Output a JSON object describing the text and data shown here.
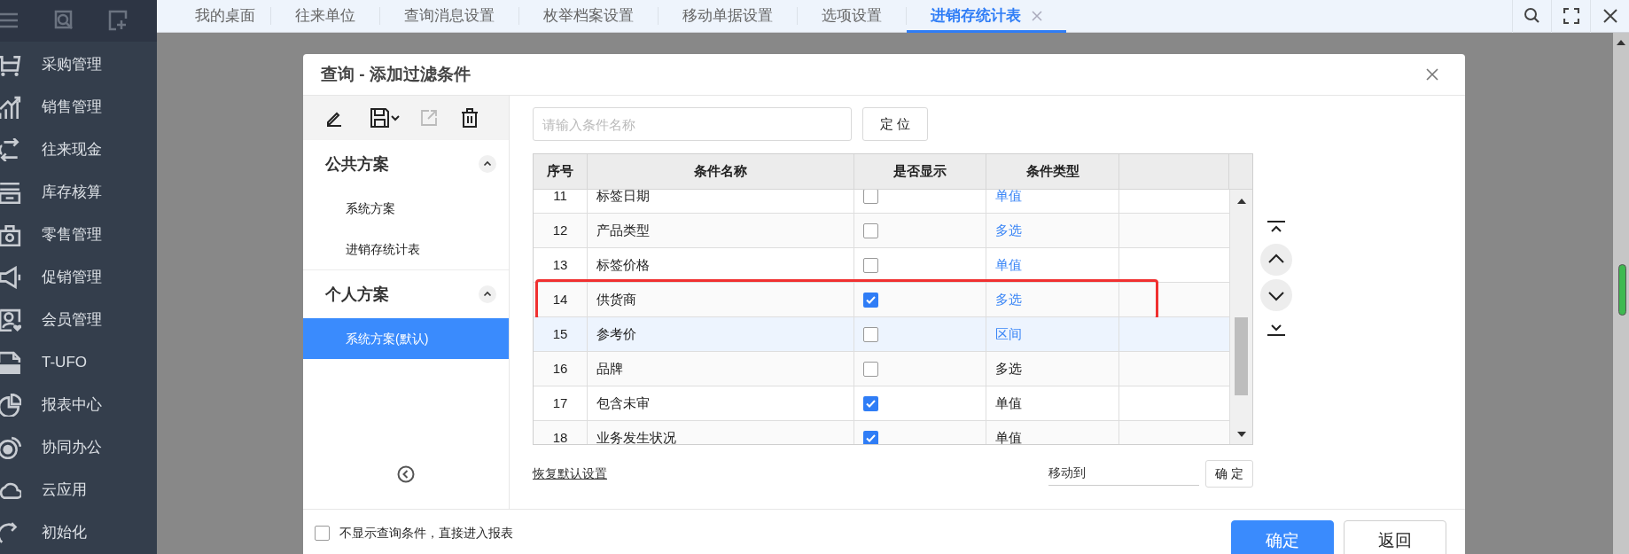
{
  "sidebar": {
    "items": [
      {
        "label": "采购管理",
        "kind": "cart"
      },
      {
        "label": "销售管理",
        "kind": "chart"
      },
      {
        "label": "往来现金",
        "kind": "swap"
      },
      {
        "label": "库存核算",
        "kind": "stock"
      },
      {
        "label": "零售管理",
        "kind": "bag"
      },
      {
        "label": "促销管理",
        "kind": "horn"
      },
      {
        "label": "会员管理",
        "kind": "member"
      },
      {
        "label": "T-UFO",
        "kind": "file"
      },
      {
        "label": "报表中心",
        "kind": "pie"
      },
      {
        "label": "协同办公",
        "kind": "signal"
      },
      {
        "label": "云应用",
        "kind": "cloud"
      },
      {
        "label": "初始化",
        "kind": "refresh"
      }
    ]
  },
  "tabs": [
    {
      "label": "我的桌面",
      "selected": false
    },
    {
      "label": "往来单位",
      "selected": false
    },
    {
      "label": "查询消息设置",
      "selected": false
    },
    {
      "label": "枚举档案设置",
      "selected": false
    },
    {
      "label": "移动单据设置",
      "selected": false
    },
    {
      "label": "选项设置",
      "selected": false
    },
    {
      "label": "进销存统计表",
      "selected": true
    }
  ],
  "dialog": {
    "title": "查询 - 添加过滤条件",
    "schemes": [
      {
        "title": "公共方案",
        "expanded": true,
        "items": [
          {
            "label": "系统方案",
            "selected": false
          },
          {
            "label": "进销存统计表",
            "selected": false
          }
        ]
      },
      {
        "title": "个人方案",
        "expanded": true,
        "items": [
          {
            "label": "系统方案(默认)",
            "selected": true
          }
        ]
      }
    ],
    "search": {
      "placeholder": "请输入条件名称"
    },
    "locate_button": "定 位",
    "table": {
      "columns": [
        "序号",
        "条件名称",
        "是否显示",
        "条件类型"
      ],
      "rows": [
        {
          "index": "11",
          "name": "标签日期",
          "shown": false,
          "type": "单值",
          "link": true,
          "selected": false,
          "marked": false
        },
        {
          "index": "12",
          "name": "产品类型",
          "shown": false,
          "type": "多选",
          "link": true,
          "selected": false,
          "marked": false
        },
        {
          "index": "13",
          "name": "标签价格",
          "shown": false,
          "type": "单值",
          "link": true,
          "selected": false,
          "marked": false
        },
        {
          "index": "14",
          "name": "供货商",
          "shown": true,
          "type": "多选",
          "link": true,
          "selected": false,
          "marked": true
        },
        {
          "index": "15",
          "name": "参考价",
          "shown": false,
          "type": "区间",
          "link": true,
          "selected": true,
          "marked": false
        },
        {
          "index": "16",
          "name": "品牌",
          "shown": false,
          "type": "多选",
          "link": false,
          "selected": false,
          "marked": false
        },
        {
          "index": "17",
          "name": "包含未审",
          "shown": true,
          "type": "单值",
          "link": false,
          "selected": false,
          "marked": false
        },
        {
          "index": "18",
          "name": "业务发生状况",
          "shown": true,
          "type": "单值",
          "link": false,
          "selected": false,
          "marked": false
        }
      ]
    },
    "restore_link": "恢复默认设置",
    "move_to_field": {
      "value": "移动到"
    },
    "move_confirm": "确 定",
    "skip_checkbox": {
      "label": "不显示查询条件，直接进入报表",
      "checked": false
    },
    "buttons": [
      {
        "label": "确定",
        "kind": "primary"
      },
      {
        "label": "返回",
        "kind": "default"
      }
    ]
  }
}
